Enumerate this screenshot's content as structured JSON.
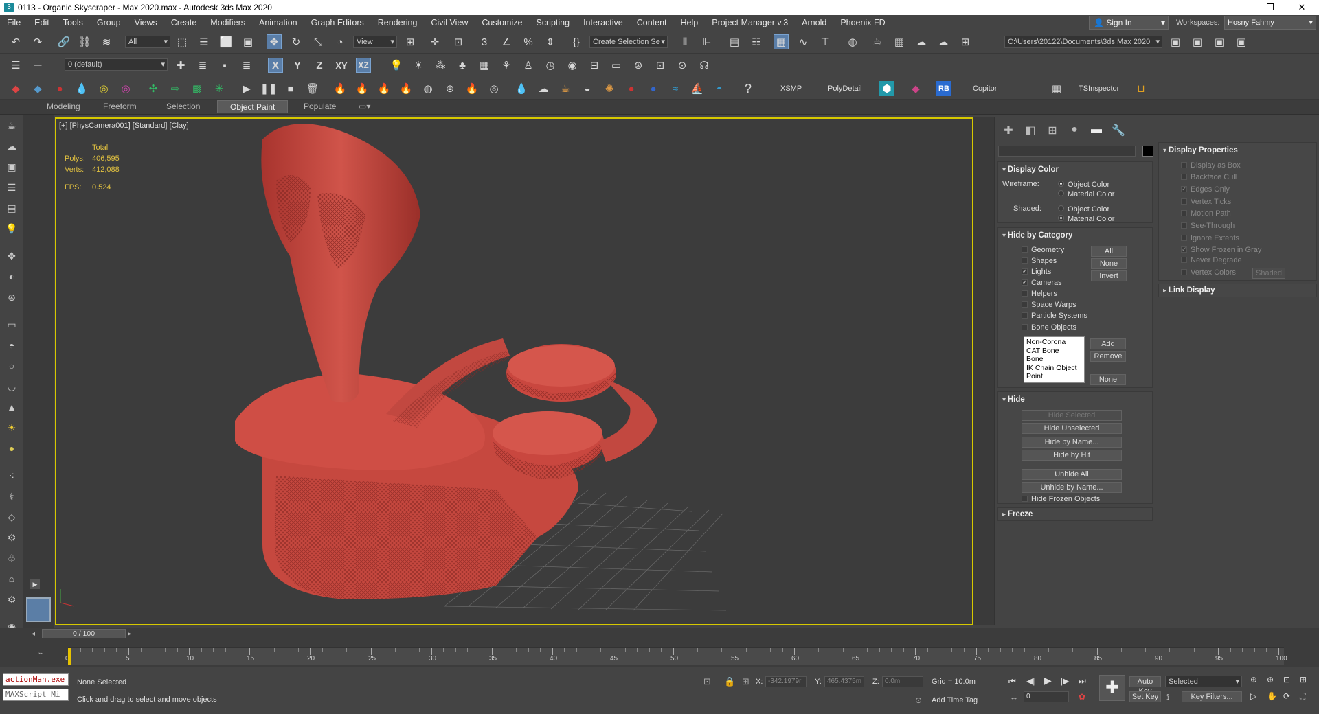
{
  "titlebar": {
    "title": "0113 - Organic Skyscraper - Max 2020.max - Autodesk 3ds Max 2020",
    "minimize": "—",
    "maximize": "❐",
    "close": "✕"
  },
  "menu": [
    "File",
    "Edit",
    "Tools",
    "Group",
    "Views",
    "Create",
    "Modifiers",
    "Animation",
    "Graph Editors",
    "Rendering",
    "Civil View",
    "Customize",
    "Scripting",
    "Interactive",
    "Content",
    "Help",
    "Project Manager v.3",
    "Arnold",
    "Phoenix FD"
  ],
  "signin": "Sign In",
  "workspaces": {
    "label": "Workspaces:",
    "value": "Hosny Fahmy"
  },
  "toolbar1": {
    "filter": "All",
    "refcoord": "View",
    "selset": "Create Selection Se",
    "path": "C:\\Users\\20122\\Documents\\3ds Max 2020"
  },
  "toolbar2": {
    "layer": "0 (default)",
    "x": "X",
    "y": "Y",
    "z": "Z",
    "xy": "XY",
    "xz": "XZ"
  },
  "toolbar3": {
    "xsmp": "XSMP",
    "polydetail": "PolyDetail",
    "rb": "RB",
    "copitor": "Copitor",
    "tsinspector": "TSInspector"
  },
  "ribbon": [
    "Modeling",
    "Freeform",
    "Selection",
    "Object Paint",
    "Populate"
  ],
  "viewport": {
    "label": "[+] [PhysCamera001] [Standard] [Clay]",
    "stats_header": "Total",
    "polys_label": "Polys:",
    "polys": "406,595",
    "verts_label": "Verts:",
    "verts": "412,088",
    "fps_label": "FPS:",
    "fps": "0.524"
  },
  "display_color": {
    "title": "Display Color",
    "wireframe_label": "Wireframe:",
    "shaded_label": "Shaded:",
    "object_color": "Object Color",
    "material_color": "Material Color"
  },
  "hide_by_category": {
    "title": "Hide by Category",
    "items": [
      {
        "label": "Geometry",
        "checked": false
      },
      {
        "label": "Shapes",
        "checked": false
      },
      {
        "label": "Lights",
        "checked": true
      },
      {
        "label": "Cameras",
        "checked": true
      },
      {
        "label": "Helpers",
        "checked": false
      },
      {
        "label": "Space Warps",
        "checked": false
      },
      {
        "label": "Particle Systems",
        "checked": false
      },
      {
        "label": "Bone Objects",
        "checked": false
      }
    ],
    "btn_all": "All",
    "btn_none": "None",
    "btn_invert": "Invert",
    "list": [
      "Non-Corona",
      "CAT Bone",
      "Bone",
      "IK Chain Object",
      "Point"
    ],
    "btn_add": "Add",
    "btn_remove": "Remove",
    "btn_none2": "None"
  },
  "hide": {
    "title": "Hide",
    "hide_selected": "Hide Selected",
    "hide_unselected": "Hide Unselected",
    "hide_by_name": "Hide by Name...",
    "hide_by_hit": "Hide by Hit",
    "unhide_all": "Unhide All",
    "unhide_by_name": "Unhide by Name...",
    "hide_frozen": "Hide Frozen Objects"
  },
  "freeze": {
    "title": "Freeze"
  },
  "display_properties": {
    "title": "Display Properties",
    "items": [
      {
        "label": "Display as Box",
        "checked": false
      },
      {
        "label": "Backface Cull",
        "checked": false
      },
      {
        "label": "Edges Only",
        "checked": true
      },
      {
        "label": "Vertex Ticks",
        "checked": false
      },
      {
        "label": "Motion Path",
        "checked": false
      },
      {
        "label": "See-Through",
        "checked": false
      },
      {
        "label": "Ignore Extents",
        "checked": false
      },
      {
        "label": "Show Frozen in Gray",
        "checked": true
      },
      {
        "label": "Never Degrade",
        "checked": false
      },
      {
        "label": "Vertex Colors",
        "checked": false
      }
    ],
    "shaded_btn": "Shaded"
  },
  "link_display": {
    "title": "Link Display"
  },
  "timeline": {
    "frame": "0 / 100",
    "ticks": [
      "0",
      "5",
      "10",
      "15",
      "20",
      "25",
      "30",
      "35",
      "40",
      "45",
      "50",
      "55",
      "60",
      "65",
      "70",
      "75",
      "80",
      "85",
      "90",
      "95",
      "100"
    ]
  },
  "status": {
    "script1": "actionMan.exe",
    "script2": "MAXScript Mi",
    "selected": "None Selected",
    "prompt": "Click and drag to select and move objects",
    "x_label": "X:",
    "x": "-342.1979r",
    "y_label": "Y:",
    "y": "465.4375m",
    "z_label": "Z:",
    "z": "0.0m",
    "grid": "Grid = 10.0m",
    "add_time_tag": "Add Time Tag",
    "auto_key": "Auto Key",
    "set_key": "Set Key",
    "selected_dd": "Selected",
    "key_filters": "Key Filters...",
    "frame_value": "0"
  },
  "colors": {
    "accent": "#d6c800",
    "object": "#c94c44",
    "active_tool": "#5a7ea8"
  }
}
